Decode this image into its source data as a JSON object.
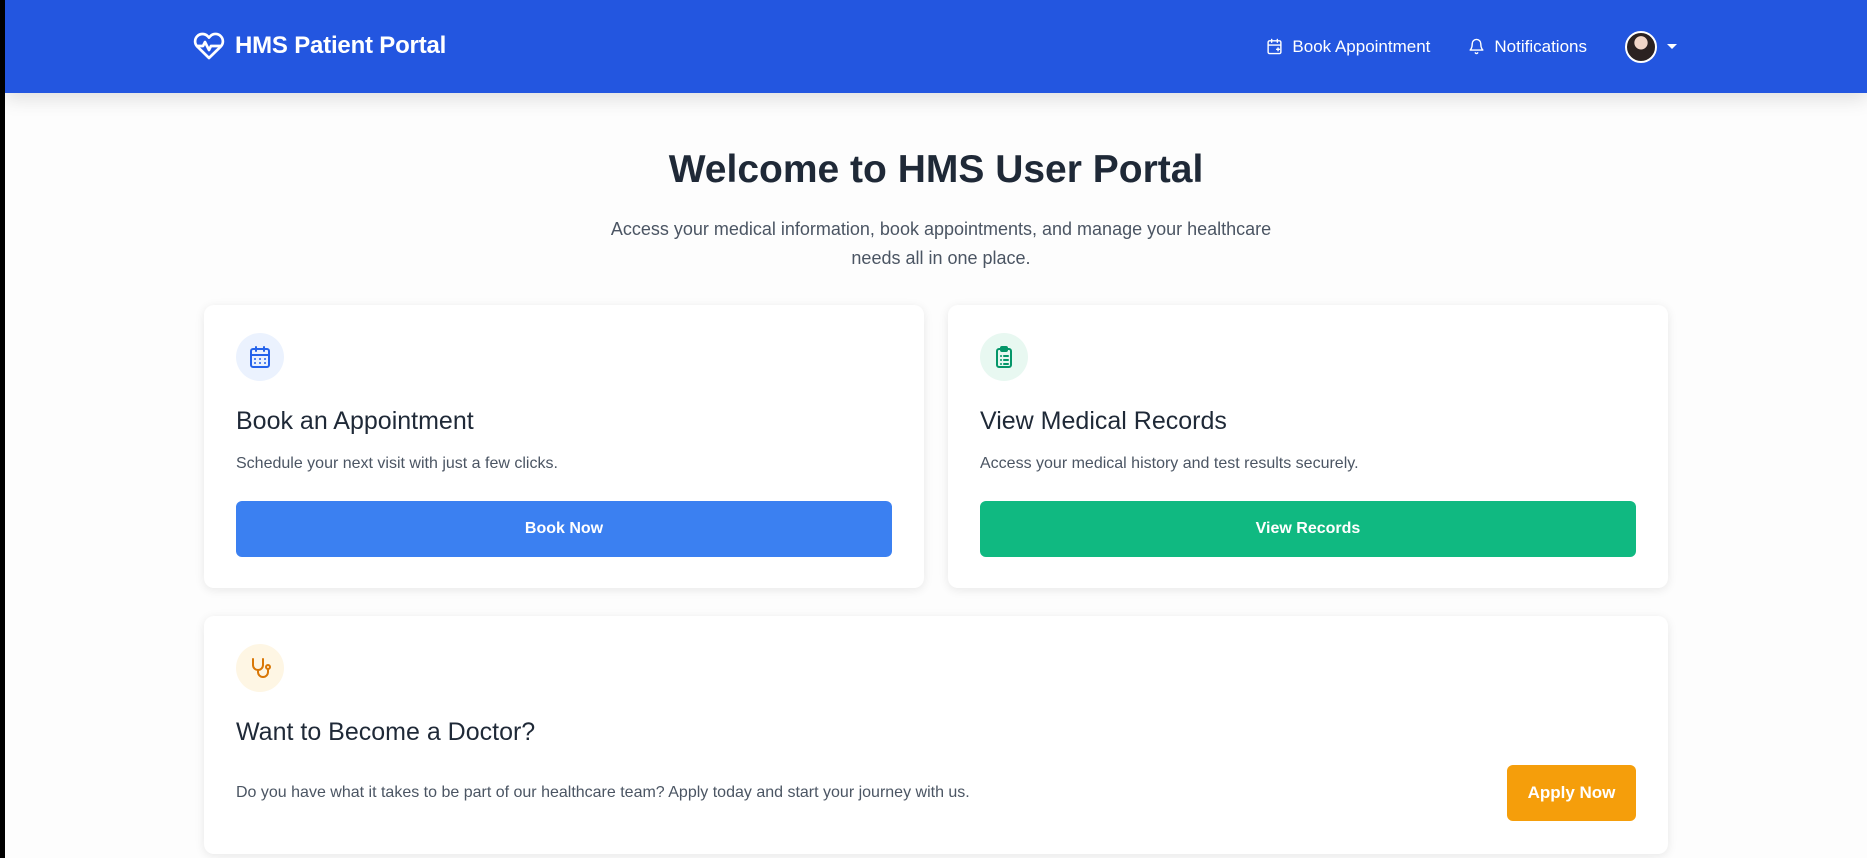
{
  "navbar": {
    "brand": "HMS Patient Portal",
    "book_appointment": "Book Appointment",
    "notifications": "Notifications"
  },
  "hero": {
    "title": "Welcome to HMS User Portal",
    "subtitle": "Access your medical information, book appointments, and manage your healthcare needs all in one place."
  },
  "cards": [
    {
      "icon": "calendar-icon",
      "title": "Book an Appointment",
      "text": "Schedule your next visit with just a few clicks.",
      "button": "Book Now",
      "accent": "#3b80f1"
    },
    {
      "icon": "clipboard-icon",
      "title": "View Medical Records",
      "text": "Access your medical history and test results securely.",
      "button": "View Records",
      "accent": "#10b981"
    },
    {
      "icon": "stethoscope-icon",
      "title": "Want to Become a Doctor?",
      "text": "Do you have what it takes to be part of our healthcare team? Apply today and start your journey with us.",
      "button": "Apply Now",
      "accent": "#f59e0b"
    }
  ],
  "colors": {
    "navbar": "#2356e0"
  }
}
